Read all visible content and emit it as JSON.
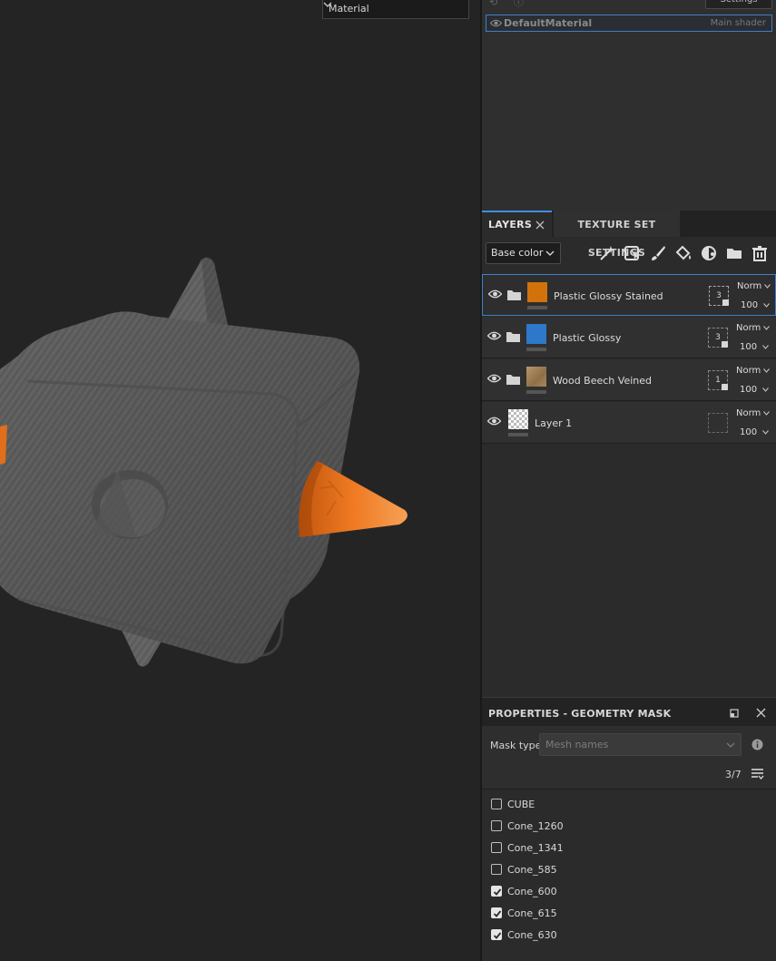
{
  "viewport": {
    "channel_select": "Material"
  },
  "shader": {
    "settings_stub": "Settings",
    "name": "DefaultMaterial",
    "tag": "Main shader"
  },
  "tabs": {
    "layers": "LAYERS",
    "texture_set_settings": "TEXTURE SET SETTINGS"
  },
  "toolbar": {
    "channel": "Base color",
    "tools": [
      "magic-wand-icon",
      "smart-mask-icon",
      "paint-brush-icon",
      "fill-bucket-icon",
      "color-selection-icon",
      "folder-icon",
      "trash-icon"
    ]
  },
  "layers": [
    {
      "name": "Plastic Glossy Stained",
      "color": "#d1720c",
      "mask": "3",
      "blend": "Norm",
      "opacity": "100",
      "selected": true
    },
    {
      "name": "Plastic Glossy",
      "color": "#2e78c9",
      "mask": "3",
      "blend": "Norm",
      "opacity": "100",
      "selected": false
    },
    {
      "name": "Wood Beech Veined",
      "color": "#a8875e",
      "mask": "1",
      "blend": "Norm",
      "opacity": "100",
      "selected": false
    },
    {
      "name": "Layer 1",
      "color": "checker",
      "mask": "",
      "blend": "Norm",
      "opacity": "100",
      "selected": false
    }
  ],
  "properties": {
    "title": "PROPERTIES - GEOMETRY MASK",
    "mask_type_label": "Mask type",
    "mask_type_value": "Mesh names",
    "count": "3/7",
    "meshes": [
      {
        "name": "CUBE",
        "checked": false
      },
      {
        "name": "Cone_1260",
        "checked": false
      },
      {
        "name": "Cone_1341",
        "checked": false
      },
      {
        "name": "Cone_585",
        "checked": false
      },
      {
        "name": "Cone_600",
        "checked": true
      },
      {
        "name": "Cone_615",
        "checked": true
      },
      {
        "name": "Cone_630",
        "checked": true
      }
    ]
  }
}
